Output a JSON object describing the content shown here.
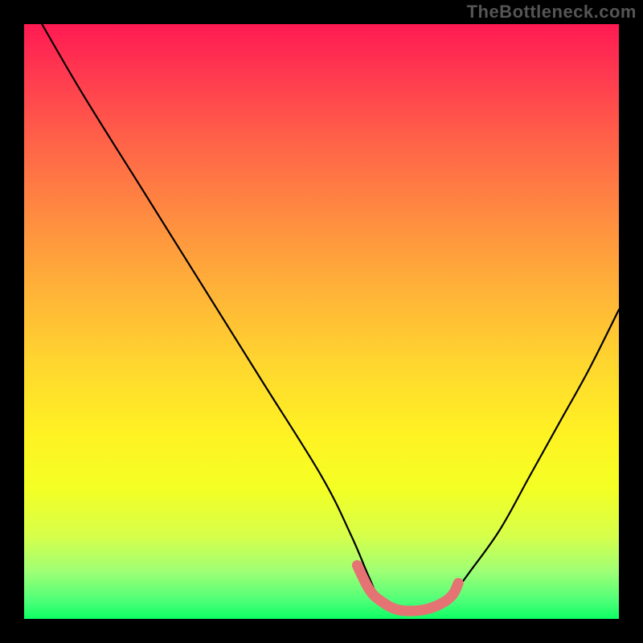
{
  "watermark": "TheBottleneck.com",
  "chart_data": {
    "type": "line",
    "title": "",
    "xlabel": "",
    "ylabel": "",
    "xlim": [
      0,
      100
    ],
    "ylim": [
      0,
      100
    ],
    "series": [
      {
        "name": "bottleneck-curve",
        "x": [
          3,
          10,
          20,
          30,
          40,
          50,
          55,
          58,
          60,
          63,
          67,
          70,
          72,
          75,
          80,
          85,
          90,
          95,
          100
        ],
        "y": [
          100,
          88,
          72,
          56,
          40,
          24,
          14,
          7,
          3,
          1,
          1,
          2,
          4,
          8,
          15,
          24,
          33,
          42,
          52
        ]
      },
      {
        "name": "optimal-band",
        "x": [
          56,
          58,
          60,
          63,
          67,
          70,
          72,
          73
        ],
        "y": [
          9,
          5,
          3,
          1.5,
          1.5,
          2.5,
          4,
          6
        ]
      }
    ],
    "colors": {
      "curve": "#000000",
      "band": "#e57373"
    }
  }
}
